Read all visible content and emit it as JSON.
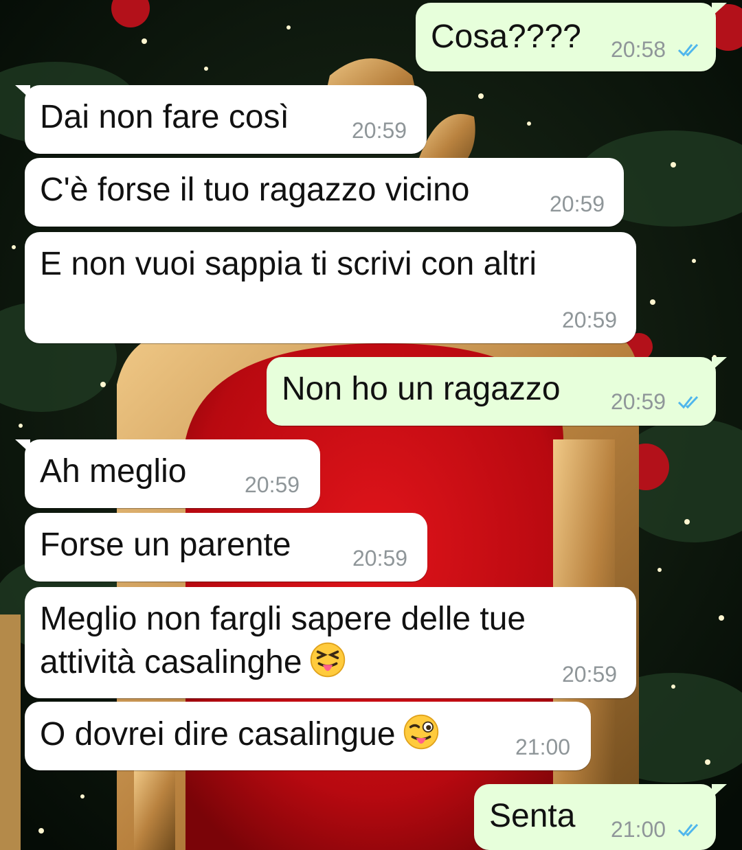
{
  "chat": {
    "messages": [
      {
        "direction": "outgoing",
        "text": "Cosa????",
        "time": "20:58",
        "status": "read"
      },
      {
        "direction": "incoming",
        "text": "Dai non fare così",
        "time": "20:59"
      },
      {
        "direction": "incoming",
        "text": "C'è forse il tuo ragazzo vicino",
        "time": "20:59"
      },
      {
        "direction": "incoming",
        "text": "E non vuoi sappia ti scrivi con altri",
        "time": "20:59"
      },
      {
        "direction": "outgoing",
        "text": "Non ho un ragazzo",
        "time": "20:59",
        "status": "read"
      },
      {
        "direction": "incoming",
        "text": "Ah meglio",
        "time": "20:59"
      },
      {
        "direction": "incoming",
        "text": "Forse un parente",
        "time": "20:59"
      },
      {
        "direction": "incoming",
        "text_line1": "Meglio non fargli sapere delle tue",
        "text_line2": "attività casalinghe",
        "emoji": "squinting-face-with-tongue",
        "time": "20:59"
      },
      {
        "direction": "incoming",
        "text": "O dovrei dire casalingue",
        "emoji": "winking-face-with-tongue",
        "time": "21:00"
      },
      {
        "direction": "outgoing",
        "text": "Senta",
        "time": "21:00",
        "status": "read"
      }
    ]
  },
  "colors": {
    "incoming_bubble": "#ffffff",
    "outgoing_bubble": "#e7ffdb",
    "read_ticks": "#4fb6ec",
    "timestamp": "#8f9699"
  }
}
